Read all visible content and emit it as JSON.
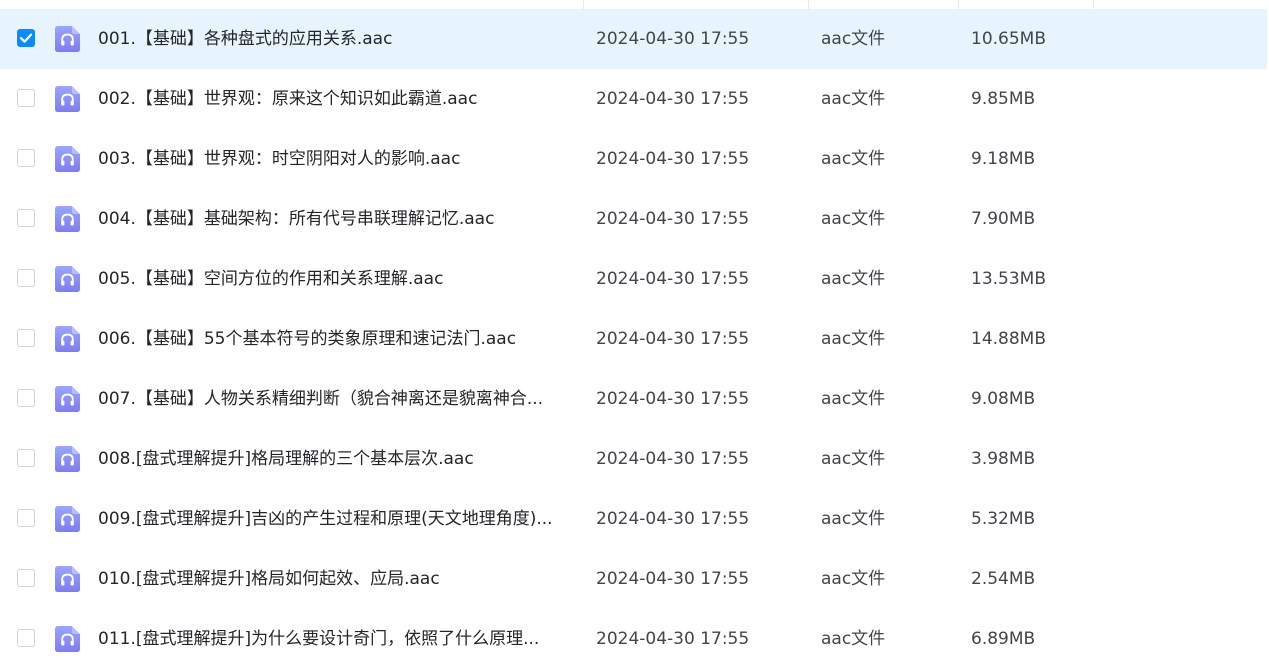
{
  "files": [
    {
      "name": "001.【基础】各种盘式的应用关系.aac",
      "date": "2024-04-30 17:55",
      "type": "aac文件",
      "size": "10.65MB",
      "selected": true
    },
    {
      "name": "002.【基础】世界观：原来这个知识如此霸道.aac",
      "date": "2024-04-30 17:55",
      "type": "aac文件",
      "size": "9.85MB",
      "selected": false
    },
    {
      "name": "003.【基础】世界观：时空阴阳对人的影响.aac",
      "date": "2024-04-30 17:55",
      "type": "aac文件",
      "size": "9.18MB",
      "selected": false
    },
    {
      "name": "004.【基础】基础架构：所有代号串联理解记忆.aac",
      "date": "2024-04-30 17:55",
      "type": "aac文件",
      "size": "7.90MB",
      "selected": false
    },
    {
      "name": "005.【基础】空间方位的作用和关系理解.aac",
      "date": "2024-04-30 17:55",
      "type": "aac文件",
      "size": "13.53MB",
      "selected": false
    },
    {
      "name": "006.【基础】55个基本符号的类象原理和速记法门.aac",
      "date": "2024-04-30 17:55",
      "type": "aac文件",
      "size": "14.88MB",
      "selected": false
    },
    {
      "name": "007.【基础】人物关系精细判断（貌合神离还是貌离神合...",
      "date": "2024-04-30 17:55",
      "type": "aac文件",
      "size": "9.08MB",
      "selected": false
    },
    {
      "name": "008.[盘式理解提升]格局理解的三个基本层次.aac",
      "date": "2024-04-30 17:55",
      "type": "aac文件",
      "size": "3.98MB",
      "selected": false
    },
    {
      "name": "009.[盘式理解提升]吉凶的产生过程和原理(天文地理角度)...",
      "date": "2024-04-30 17:55",
      "type": "aac文件",
      "size": "5.32MB",
      "selected": false
    },
    {
      "name": "010.[盘式理解提升]格局如何起效、应局.aac",
      "date": "2024-04-30 17:55",
      "type": "aac文件",
      "size": "2.54MB",
      "selected": false
    },
    {
      "name": "011.[盘式理解提升]为什么要设计奇门，依照了什么原理...",
      "date": "2024-04-30 17:55",
      "type": "aac文件",
      "size": "6.89MB",
      "selected": false
    }
  ],
  "icons": {
    "file_type_icon": "audio-headphones-icon",
    "check_icon": "checkmark-icon"
  },
  "colors": {
    "selected_row_bg": "#e8f4fd",
    "checkbox_checked": "#0b8bff",
    "audio_icon_top": "#9aa6ff",
    "audio_icon_bottom": "#7e7cf0",
    "text_primary": "#25262b",
    "text_secondary": "#42454c"
  }
}
